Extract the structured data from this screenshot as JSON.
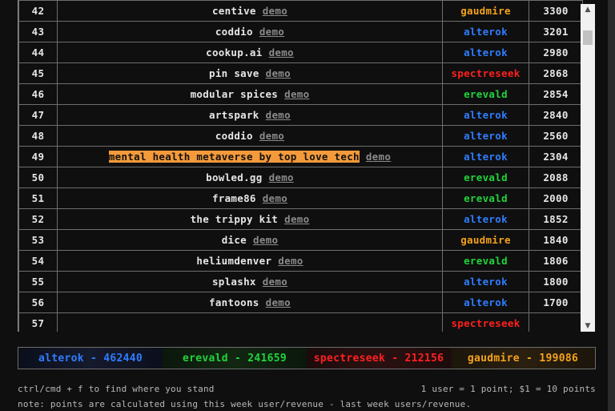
{
  "leaderboard": {
    "demo_label": "demo",
    "rows": [
      {
        "rank": "42",
        "name": "centive",
        "team": "gaudmire",
        "points": "3300",
        "highlight": false
      },
      {
        "rank": "43",
        "name": "coddio",
        "team": "alterok",
        "points": "3201",
        "highlight": false
      },
      {
        "rank": "44",
        "name": "cookup.ai",
        "team": "alterok",
        "points": "2980",
        "highlight": false
      },
      {
        "rank": "45",
        "name": "pin save",
        "team": "spectreseek",
        "points": "2868",
        "highlight": false
      },
      {
        "rank": "46",
        "name": "modular spices",
        "team": "erevald",
        "points": "2854",
        "highlight": false
      },
      {
        "rank": "47",
        "name": "artspark",
        "team": "alterok",
        "points": "2840",
        "highlight": false
      },
      {
        "rank": "48",
        "name": "coddio",
        "team": "alterok",
        "points": "2560",
        "highlight": false
      },
      {
        "rank": "49",
        "name": "mental health metaverse by top love tech",
        "team": "alterok",
        "points": "2304",
        "highlight": true
      },
      {
        "rank": "50",
        "name": "bowled.gg",
        "team": "erevald",
        "points": "2088",
        "highlight": false
      },
      {
        "rank": "51",
        "name": "frame86",
        "team": "erevald",
        "points": "2000",
        "highlight": false
      },
      {
        "rank": "52",
        "name": "the trippy kit",
        "team": "alterok",
        "points": "1852",
        "highlight": false
      },
      {
        "rank": "53",
        "name": "dice",
        "team": "gaudmire",
        "points": "1840",
        "highlight": false
      },
      {
        "rank": "54",
        "name": "heliumdenver",
        "team": "erevald",
        "points": "1806",
        "highlight": false
      },
      {
        "rank": "55",
        "name": "splashx",
        "team": "alterok",
        "points": "1800",
        "highlight": false
      },
      {
        "rank": "56",
        "name": "fantoons",
        "team": "alterok",
        "points": "1700",
        "highlight": false
      },
      {
        "rank": "57",
        "name": "",
        "team": "spectreseek",
        "points": "",
        "highlight": false
      }
    ]
  },
  "team_colors": {
    "alterok": "#2f7dff",
    "erevald": "#20d43a",
    "spectreseek": "#ff2020",
    "gaudmire": "#f5a21b"
  },
  "scoreboard": {
    "alterok": "alterok - 462440",
    "erevald": "erevald - 241659",
    "spectreseek": "spectreseek - 212156",
    "gaudmire": "gaudmire - 199086"
  },
  "footer": {
    "hint": "ctrl/cmd + f to find where you stand",
    "rule": "1 user = 1 point; $1 = 10 points",
    "note": "note: points are calculated using this week user/revenue - last week users/revenue."
  },
  "icons": {
    "scroll_up": "triangle-up",
    "scroll_down": "triangle-down"
  }
}
